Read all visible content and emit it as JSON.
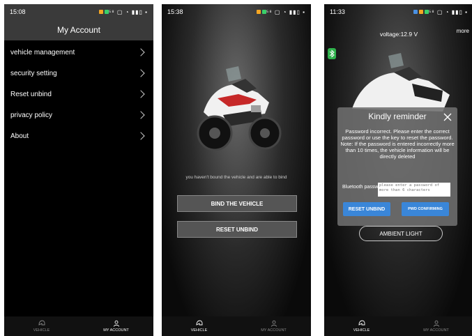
{
  "screen1": {
    "status": {
      "time": "15:08",
      "sys": "⁵⁸ ▢ ◔ ▮▮▯ ▪"
    },
    "title": "My Account",
    "menu": [
      {
        "label": "vehicle management"
      },
      {
        "label": "security setting"
      },
      {
        "label": "Reset unbind"
      },
      {
        "label": "privacy policy"
      },
      {
        "label": "About"
      }
    ],
    "tabs": {
      "vehicle": "VEHICLE",
      "account": "MY ACCOUNT"
    }
  },
  "screen2": {
    "status": {
      "time": "15:38",
      "sys": "⁵⁸ ▢ ◔ ▮▮▯ ▪"
    },
    "hint": "you haven't bound the vehicle and are able to bind",
    "bind_button": "BIND THE VEHICLE",
    "reset_button": "RESET UNBIND",
    "tabs": {
      "vehicle": "VEHICLE",
      "account": "MY ACCOUNT"
    }
  },
  "screen3": {
    "status": {
      "time": "11:33",
      "sys": "⁵⁸ ▢ ◔ ▮▮▯ ▪"
    },
    "voltage": "voltage:12.9 V",
    "more": "more",
    "dialog": {
      "title": "Kindly reminder",
      "message": "Password incorrect. Please enter the correct password or use the key to reset the password. Note: If the password is entered incorrectly more than 10 times, the vehicle information will be directly deleted",
      "password_label": "Bluetooth password",
      "password_placeholder": "please enter a password of more than 6 characters",
      "reset_button": "RESET UNBIND",
      "confirm_button": "PWD CONFIRMING"
    },
    "ambient_button": "AMBIENT LIGHT",
    "tabs": {
      "vehicle": "VEHICLE",
      "account": "MY ACCOUNT"
    }
  },
  "colors": {
    "accent_blue": "#3a86d8",
    "bluetooth_green": "#2fb24c"
  }
}
